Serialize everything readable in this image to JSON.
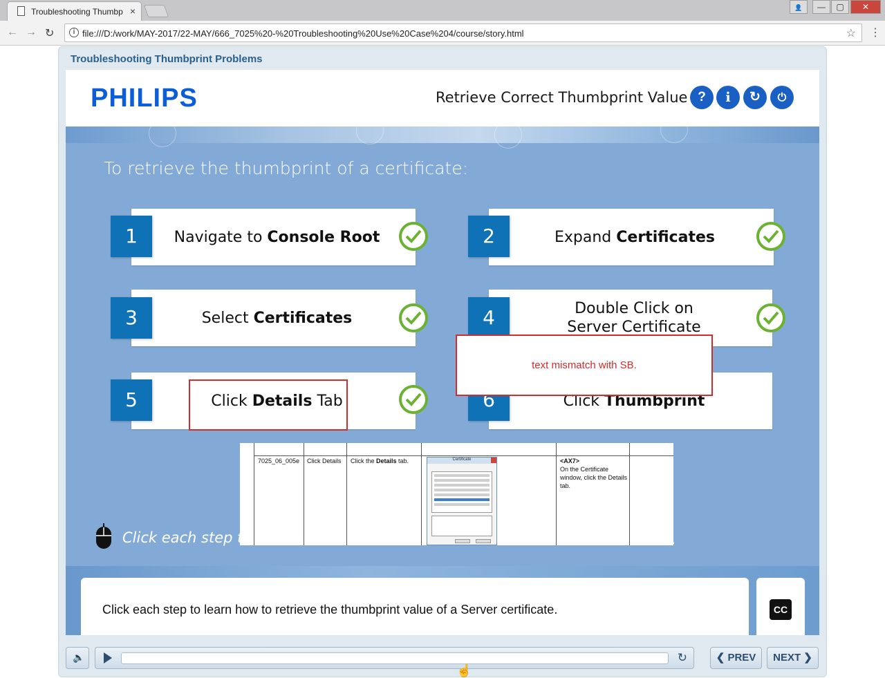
{
  "browser": {
    "tab_title": "Troubleshooting Thumbp",
    "tab_close": "×",
    "url": "file:///D:/work/MAY-2017/22-MAY/666_7025%20-%20Troubleshooting%20Use%20Case%204/course/story.html",
    "info_glyph": "i",
    "star_glyph": "☆",
    "menu_glyph": "⋮",
    "back_glyph": "←",
    "forward_glyph": "→",
    "reload_glyph": "↻",
    "win_min": "—",
    "win_max": "▢",
    "win_close": "✕",
    "win_user": "👤"
  },
  "course": {
    "title": "Troubleshooting Thumbprint Problems"
  },
  "slide": {
    "logo": "PHILIPS",
    "lesson_title": "Retrieve Correct Thumbprint Value",
    "header_buttons": [
      {
        "icon": "help-icon",
        "glyph": "?"
      },
      {
        "icon": "info-icon",
        "glyph": "i"
      },
      {
        "icon": "replay-icon",
        "glyph": "↻"
      },
      {
        "icon": "power-icon",
        "glyph": "⏻"
      }
    ],
    "intro": "To retrieve the thumbprint of a certificate:",
    "steps": [
      {
        "num": "1",
        "pre": "Navigate to ",
        "bold": "Console Root",
        "post": ""
      },
      {
        "num": "2",
        "pre": "Expand ",
        "bold": "Certificates",
        "post": ""
      },
      {
        "num": "3",
        "pre": "Select ",
        "bold": "Certificates",
        "post": ""
      },
      {
        "num": "4",
        "line1": "Double Click on",
        "line2": "Server Certificate"
      },
      {
        "num": "5",
        "pre": "Click ",
        "bold": "Details",
        "post": " Tab"
      },
      {
        "num": "6",
        "pre": "Click ",
        "bold": "Thumbprint",
        "post": ""
      }
    ],
    "hint": "Click each step to",
    "hint_tail": ".",
    "annotation_note": "text mismatch with SB.",
    "storyboard": {
      "id": "7025_06_005e",
      "action": "Click Details",
      "instruction_pre": "Click the ",
      "instruction_bold": "Details",
      "instruction_post": " tab.",
      "mini_window_title": "Certificate",
      "audio_tag": "<AX7>",
      "audio_text": "On the Certificate window, click the Details tab."
    },
    "caption": "Click each step to learn how to retrieve the thumbprint value of a Server certificate.",
    "cc_label": "CC"
  },
  "controls": {
    "volume_glyph": "🔈",
    "replay_glyph": "↻",
    "prev": "❮ PREV",
    "next": "NEXT ❯",
    "seek_progress": 0.0
  },
  "colors": {
    "accent_blue": "#0f72b6",
    "logo_blue": "#0b5ed7",
    "check_green": "#6bb132",
    "annotation_red": "#d42b2b",
    "slide_bg": "#83aad6"
  }
}
